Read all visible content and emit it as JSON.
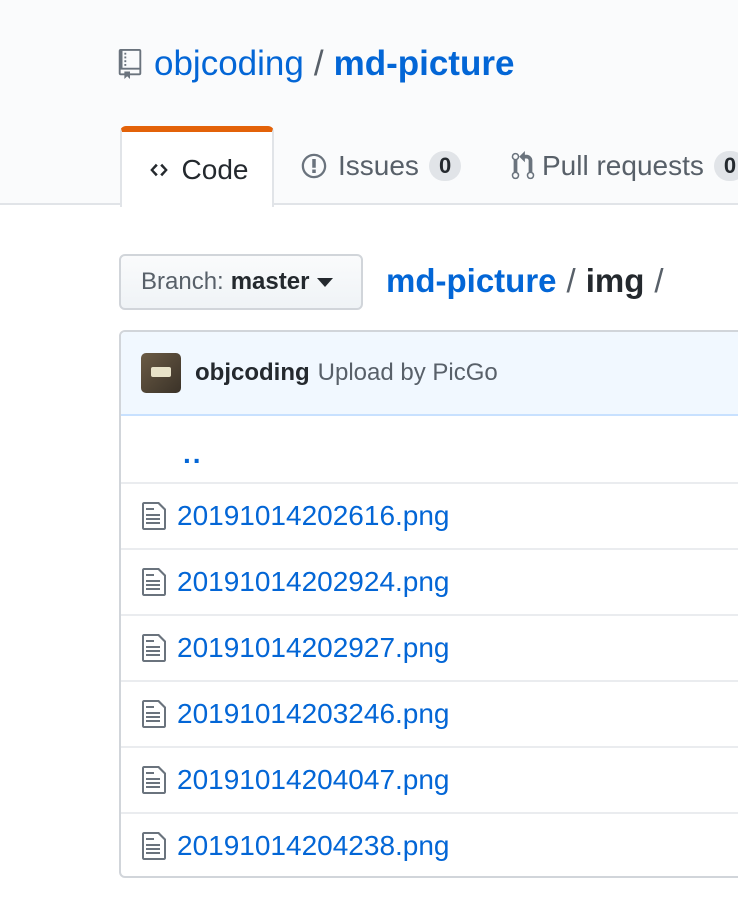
{
  "repo": {
    "owner": "objcoding",
    "separator": "/",
    "name": "md-picture"
  },
  "tabs": [
    {
      "label": "Code",
      "icon": "code-icon",
      "selected": true
    },
    {
      "label": "Issues",
      "icon": "issue-opened-icon",
      "count": "0"
    },
    {
      "label": "Pull requests",
      "icon": "git-pull-request-icon",
      "count": "0"
    }
  ],
  "branch": {
    "label": "Branch:",
    "value": "master"
  },
  "breadcrumb": {
    "root": "md-picture",
    "sep1": "/",
    "dir": "img",
    "sep2": "/"
  },
  "commit": {
    "author": "objcoding",
    "message": "Upload by PicGo"
  },
  "files": {
    "up": "..",
    "items": [
      "20191014202616.png",
      "20191014202924.png",
      "20191014202927.png",
      "20191014203246.png",
      "20191014204047.png",
      "20191014204238.png"
    ]
  },
  "colors": {
    "link": "#0366d6",
    "accent": "#e36209",
    "commit_bg": "#f1f8ff"
  }
}
